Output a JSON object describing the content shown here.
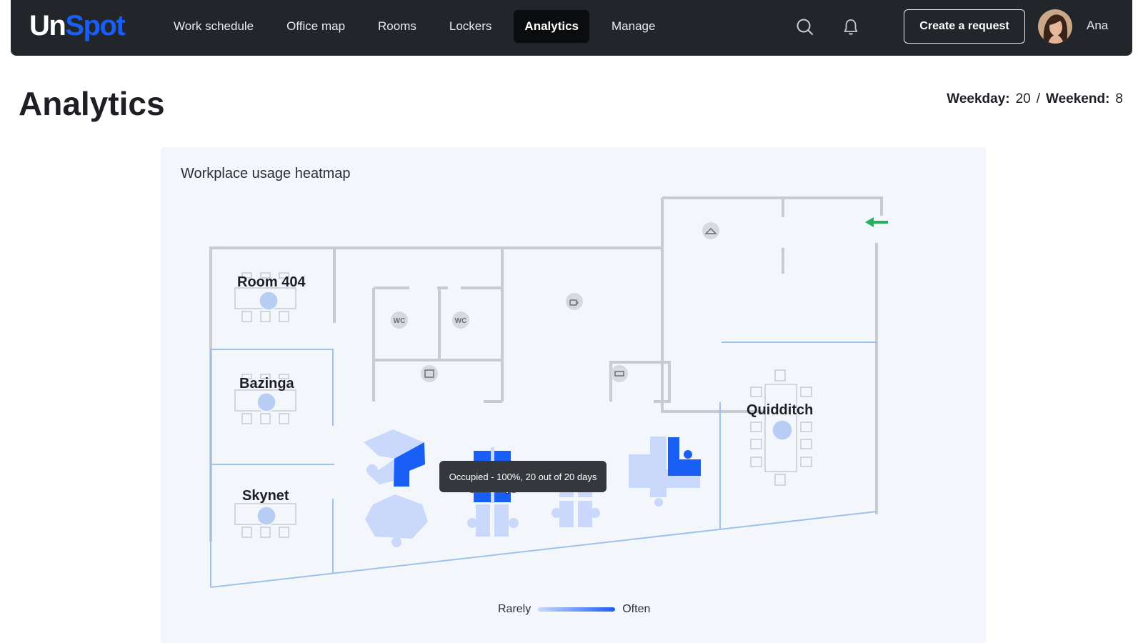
{
  "brand": {
    "logo_part1": "Un",
    "logo_part2": "Spot",
    "accent": "#1a5ff5"
  },
  "nav": {
    "items": [
      {
        "label": "Work schedule"
      },
      {
        "label": "Office map"
      },
      {
        "label": "Rooms"
      },
      {
        "label": "Lockers"
      },
      {
        "label": "Analytics",
        "active": true
      },
      {
        "label": "Manage"
      }
    ]
  },
  "header": {
    "search_icon": "search-icon",
    "bell_icon": "bell-icon",
    "create_request_label": "Create a request",
    "user_name": "Ana"
  },
  "page": {
    "title": "Analytics",
    "weekday_label": "Weekday:",
    "weekday_value": "20",
    "separator": "/",
    "weekend_label": "Weekend:",
    "weekend_value": "8"
  },
  "heatmap": {
    "title": "Workplace usage heatmap",
    "rooms": [
      "Room 404",
      "Bazinga",
      "Skynet",
      "Quidditch"
    ],
    "wc_labels": [
      "WC",
      "WC"
    ],
    "tooltip": "Occupied - 100%, 20 out of 20 days",
    "legend": {
      "low_label": "Rarely",
      "high_label": "Often"
    },
    "colors": {
      "high": "#1a5ff5",
      "low": "#c9d8fb",
      "wall": "#c8cbd0",
      "partition": "#9fc2ec"
    }
  }
}
